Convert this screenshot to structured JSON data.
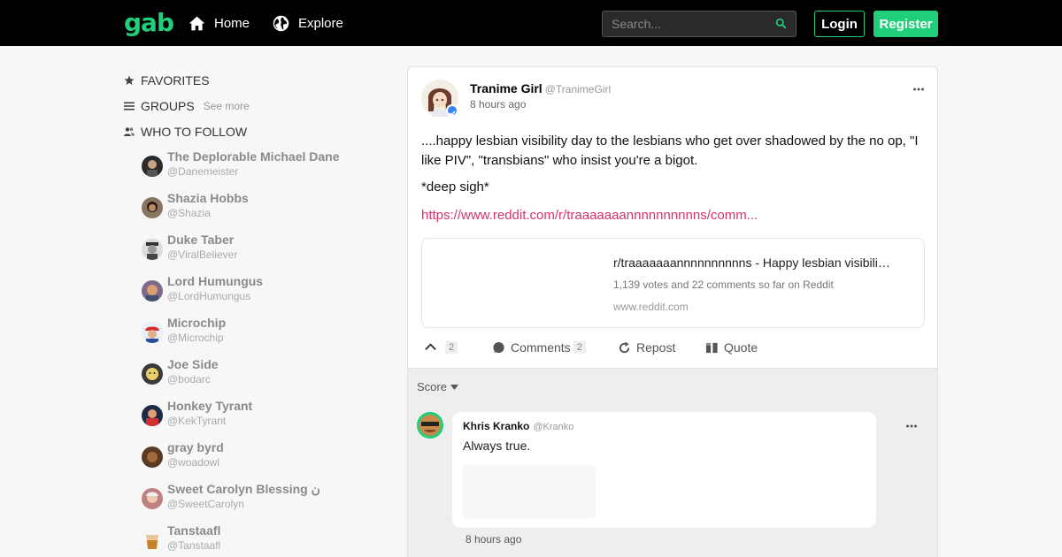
{
  "navbar": {
    "logo": "gab",
    "home_label": "Home",
    "explore_label": "Explore",
    "search_placeholder": "Search...",
    "login_label": "Login",
    "register_label": "Register",
    "accent_color": "#21cf7a"
  },
  "sidebar": {
    "favorites_label": "FAVORITES",
    "groups_label": "GROUPS",
    "groups_see_more": "See more",
    "who_to_follow_label": "WHO TO FOLLOW",
    "follow": [
      {
        "name": "The Deplorable Michael Dane",
        "handle": "@Danemeister"
      },
      {
        "name": "Shazia Hobbs",
        "handle": "@Shazia"
      },
      {
        "name": "Duke Taber",
        "handle": "@ViralBeliever"
      },
      {
        "name": "Lord Humungus",
        "handle": "@LordHumungus"
      },
      {
        "name": "Microchip",
        "handle": "@Microchip"
      },
      {
        "name": "Joe Side",
        "handle": "@bodarc"
      },
      {
        "name": "Honkey Tyrant",
        "handle": "@KekTyrant"
      },
      {
        "name": "gray byrd",
        "handle": "@woadowl"
      },
      {
        "name": "Sweet Carolyn Blessing ن",
        "handle": "@SweetCarolyn"
      },
      {
        "name": "Tanstaafl",
        "handle": "@Tanstaafl"
      }
    ]
  },
  "post": {
    "author_name": "Tranime Girl",
    "author_handle": "@TranimeGirl",
    "time": "8 hours ago",
    "text": "....happy lesbian visibility day to the lesbians who get over shadowed by the no op, \"I like PIV\", \"transbians\" who insist you're a bigot.",
    "text2": "*deep sigh*",
    "link": "https://www.reddit.com/r/traaaaaaannnnnnnnnns/comm...",
    "card": {
      "title": "r/traaaaaaannnnnnnnnns - Happy lesbian visibili…",
      "description": "1,139 votes and 22 comments so far on Reddit",
      "domain": "www.reddit.com"
    },
    "actions": {
      "like_count": "2",
      "comments_label": "Comments",
      "comments_count": "2",
      "repost_label": "Repost",
      "quote_label": "Quote"
    }
  },
  "comments": {
    "sort_label": "Score",
    "items": [
      {
        "name": "Khris Kranko",
        "handle": "@Kranko",
        "text": "Always true.",
        "time": "8 hours ago"
      }
    ]
  }
}
